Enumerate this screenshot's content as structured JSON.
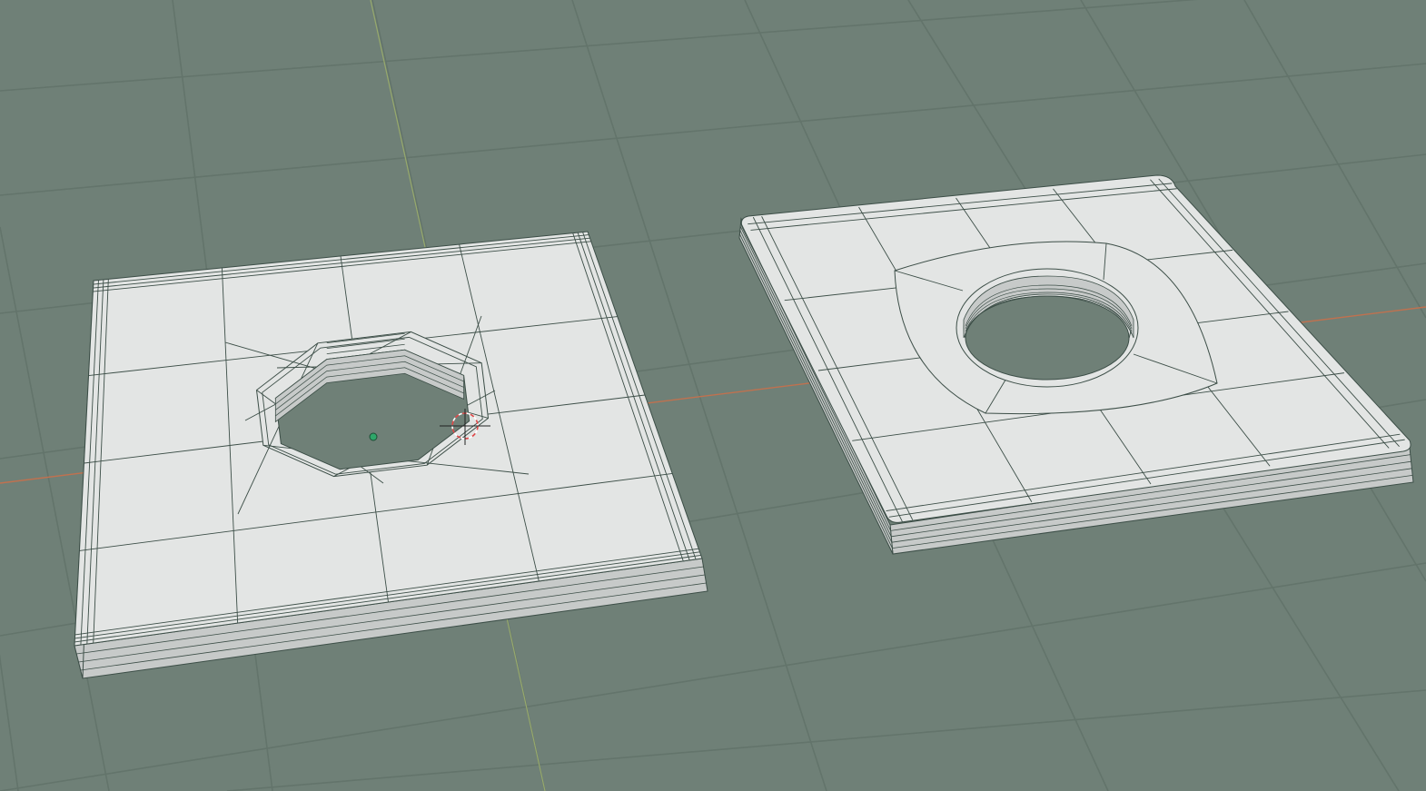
{
  "viewport": {
    "background": "#6f8077",
    "grid_line": "#63746b",
    "x_axis_color": "#c0714f",
    "y_axis_color": "#97a96c"
  },
  "mesh": {
    "top_face": "#e3e5e4",
    "side_face": "#c7cac9",
    "wire": "#3c4e47",
    "hole_floor": "#6f8077"
  },
  "scene_objects": [
    {
      "name": "plate-octagon-hole",
      "hole_shape": "octagon",
      "selected": false
    },
    {
      "name": "plate-smooth-hole",
      "hole_shape": "ellipse",
      "selected": false
    }
  ],
  "gizmos": {
    "origin_point": "origin-point",
    "cursor_3d": "3d-cursor",
    "origin_color": "#2fa76a",
    "cursor_color": "#e04848"
  }
}
